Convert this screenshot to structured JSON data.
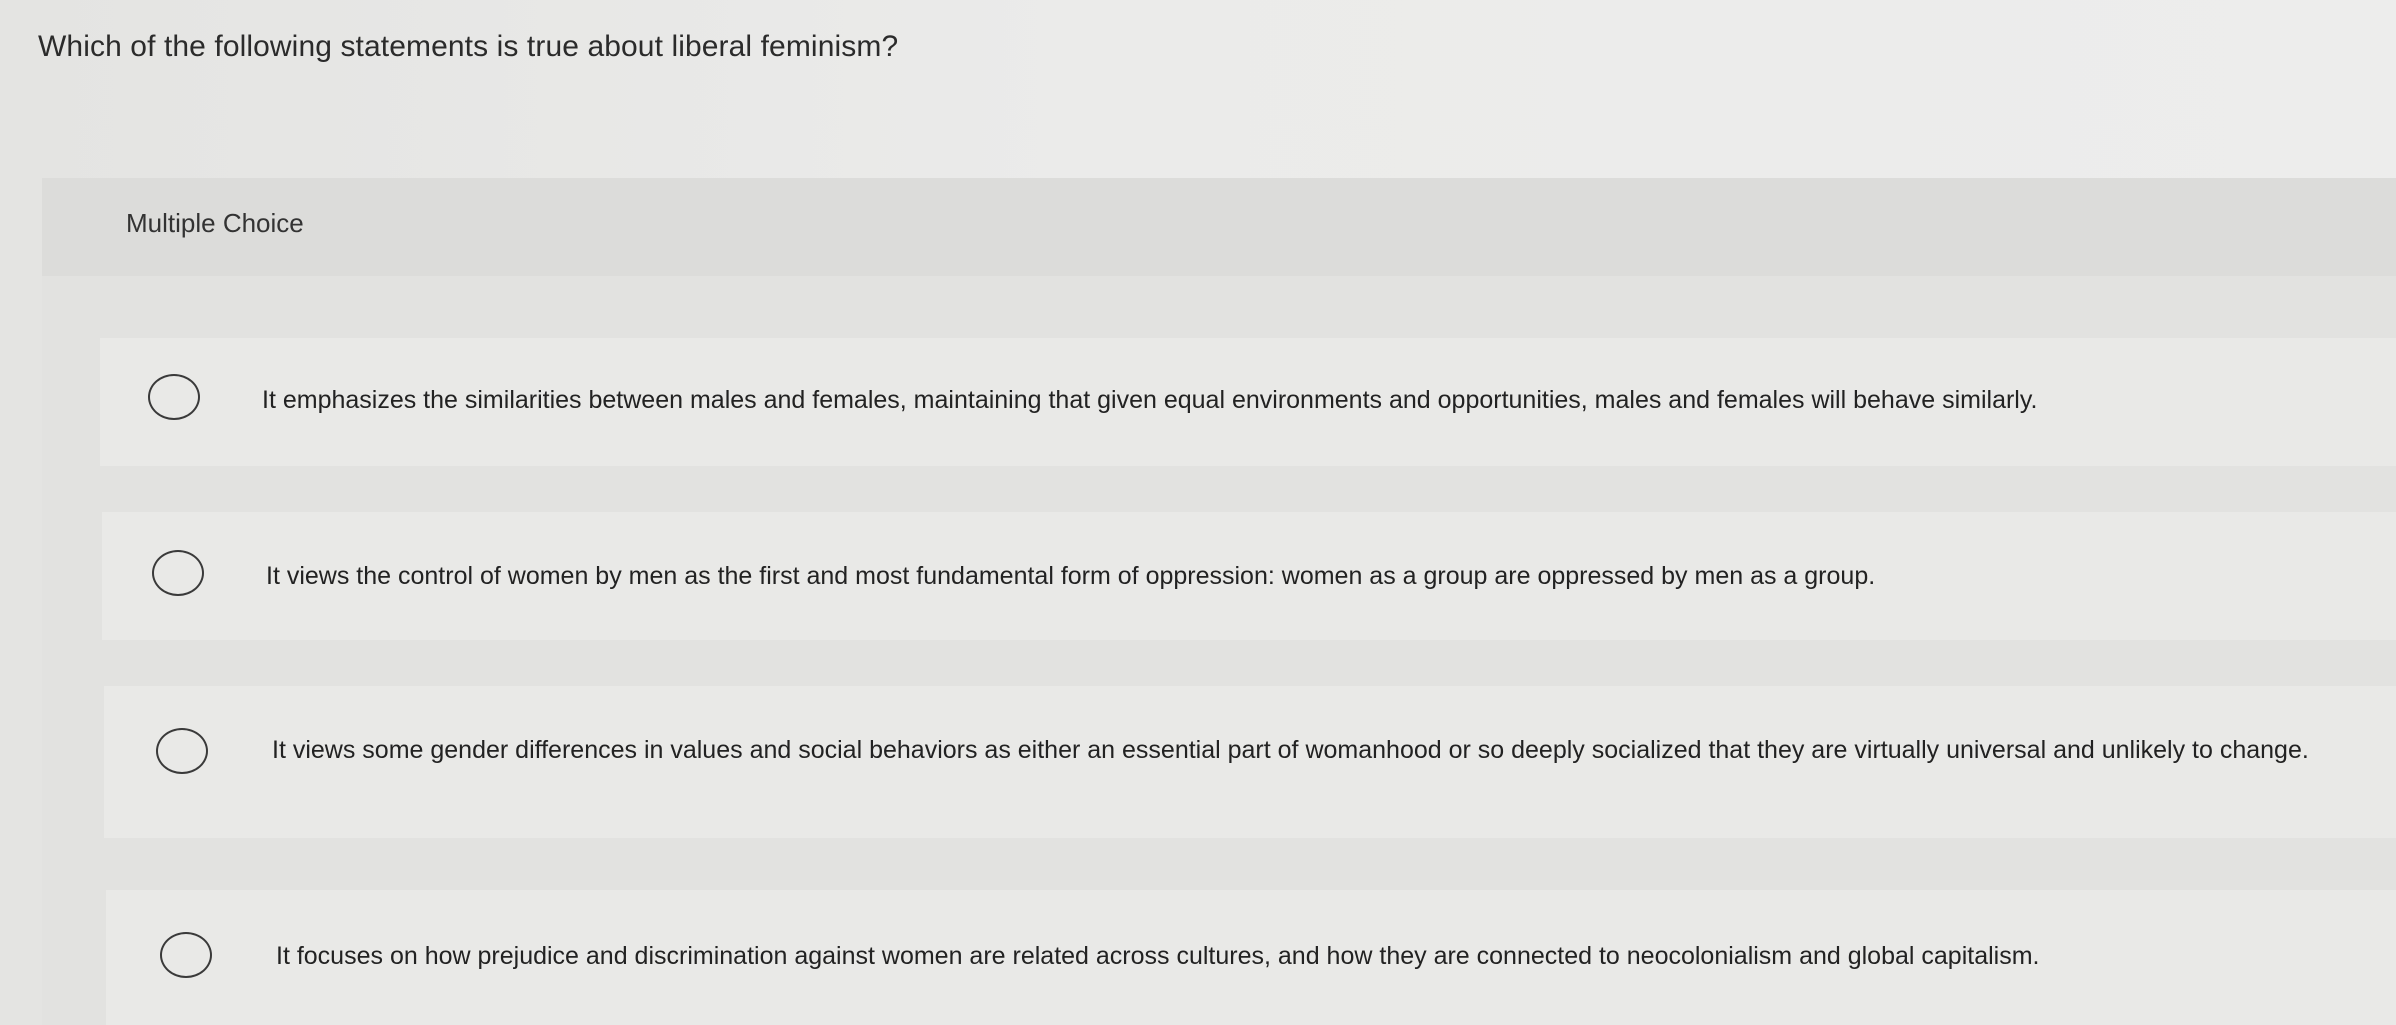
{
  "question": {
    "text": "Which of the following statements is true about liberal feminism?"
  },
  "panel": {
    "label": "Multiple Choice"
  },
  "options": [
    {
      "text": "It emphasizes the similarities between males and females, maintaining that given equal environments and opportunities, males and females will behave similarly."
    },
    {
      "text": "It views the control of women by men as the first and most fundamental form of oppression: women as a group are oppressed by men as a group."
    },
    {
      "text": "It views some gender differences in values and social behaviors as either an essential part of womanhood or so deeply socialized that they are virtually universal and unlikely to change."
    },
    {
      "text": "It focuses on how prejudice and discrimination against women are related across cultures, and how they are connected to neocolonialism and global capitalism."
    }
  ]
}
